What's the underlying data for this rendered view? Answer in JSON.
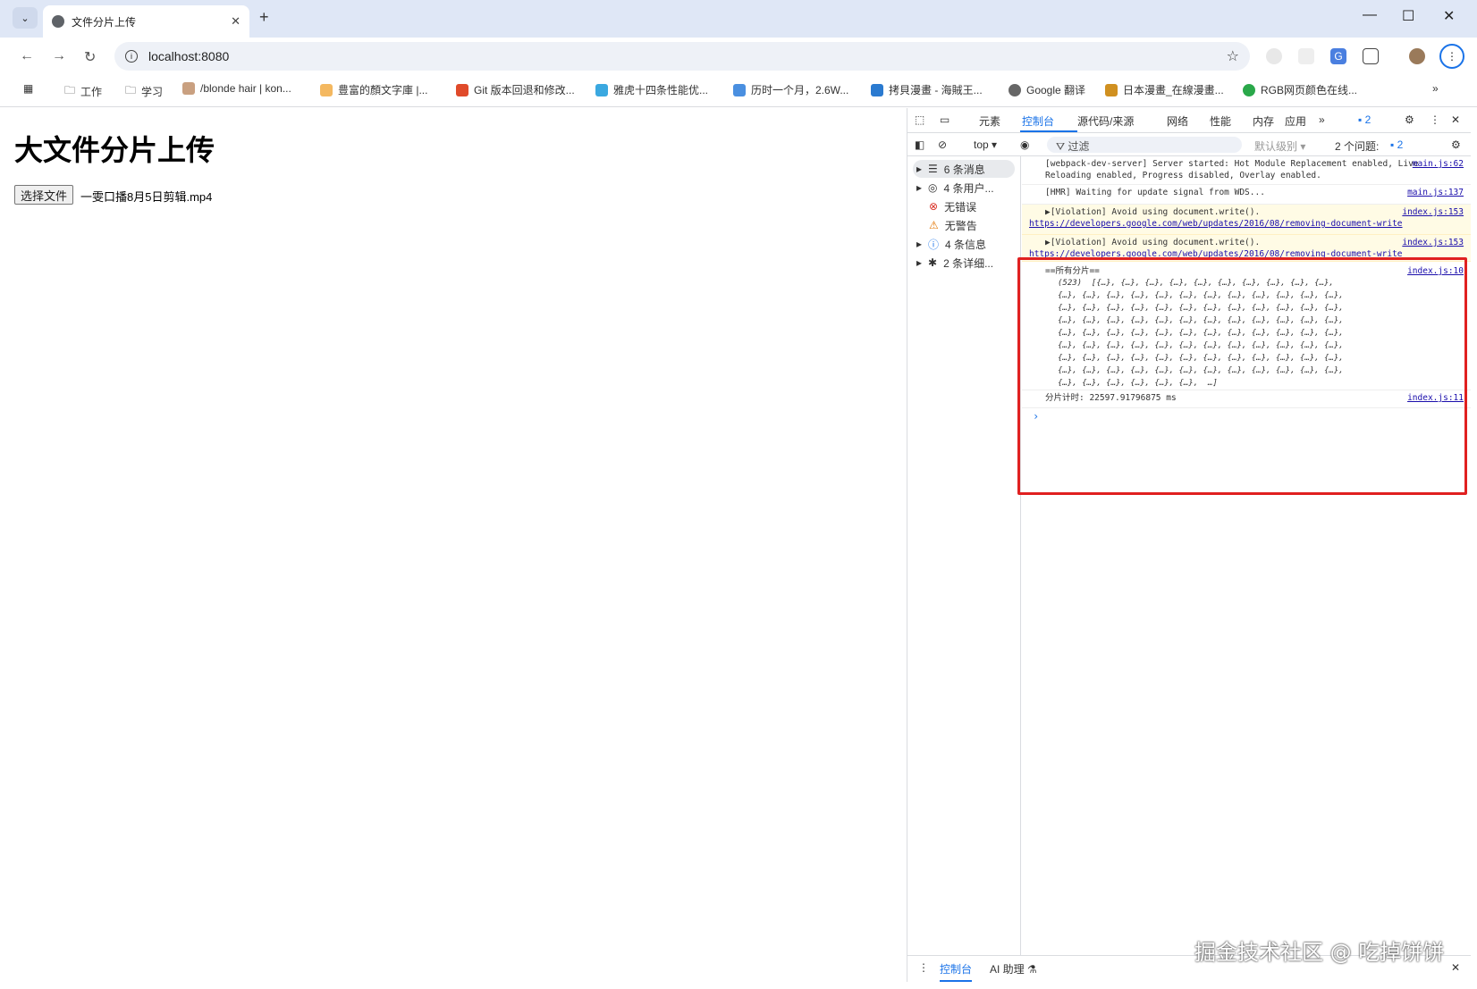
{
  "browser": {
    "tab_title": "文件分片上传",
    "url": "localhost:8080",
    "bookmarks": [
      "工作",
      "学习",
      "/blonde hair | kon...",
      "豊富的顏文字庫 |...",
      "Git 版本回退和修改...",
      "雅虎十四条性能优...",
      "历时一个月，2.6W...",
      "拷貝漫畫 - 海賊王...",
      "Google 翻译",
      "日本漫畫_在線漫畫...",
      "RGB网页颜色在线..."
    ]
  },
  "page": {
    "heading": "大文件分片上传",
    "file_button": "选择文件",
    "file_name": "一雯口播8月5日剪辑.mp4"
  },
  "devtools": {
    "tabs": [
      "元素",
      "控制台",
      "源代码/来源",
      "网络",
      "性能",
      "内存",
      "应用"
    ],
    "issues_badge": "2",
    "context": "top",
    "filter_placeholder": "过滤",
    "level": "默认级别",
    "issues_text": "2 个问题:",
    "issues_count": "2",
    "sidebar": [
      "6 条消息",
      "4 条用户...",
      "无错误",
      "无警告",
      "4 条信息",
      "2 条详细..."
    ],
    "messages": [
      {
        "text": "[webpack-dev-server] Server started: Hot Module Replacement enabled, Live Reloading enabled, Progress disabled, Overlay enabled.",
        "src": "main.js:62"
      },
      {
        "text": "[HMR] Waiting for update signal from WDS...",
        "src": "main.js:137"
      },
      {
        "text": "▶[Violation] Avoid using document.write().",
        "link": "https://developers.google.com/web/updates/2016/08/removing-document-write",
        "src": "index.js:153"
      },
      {
        "text": "▶[Violation] Avoid using document.write().",
        "link": "https://developers.google.com/web/updates/2016/08/removing-document-write",
        "src": "index.js:153"
      }
    ],
    "chunks_label": "==所有分片==",
    "chunks_src": "index.js:10",
    "chunks_count": "(523)",
    "timer_text": "分片计时: 22597.91796875 ms",
    "timer_src": "index.js:11",
    "drawer_tabs": [
      "控制台",
      "AI 助理 ⚗"
    ]
  },
  "watermark": "掘金技术社区 @ 吃掉饼饼"
}
